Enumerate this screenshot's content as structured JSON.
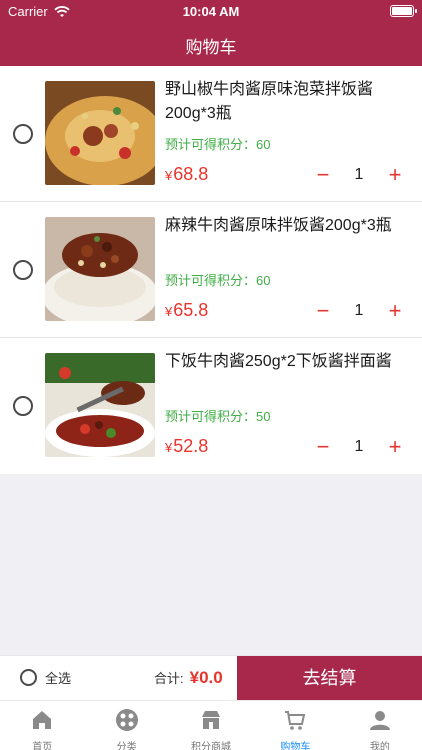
{
  "status": {
    "carrier": "Carrier",
    "time": "10:04 AM"
  },
  "header": {
    "title": "购物车"
  },
  "items": [
    {
      "name": "野山椒牛肉酱原味泡菜拌饭酱200g*3瓶",
      "points_label": "预计可得积分：60",
      "currency": "¥",
      "price": "68.8",
      "qty": "1"
    },
    {
      "name": "麻辣牛肉酱原味拌饭酱200g*3瓶",
      "points_label": "预计可得积分：60",
      "currency": "¥",
      "price": "65.8",
      "qty": "1"
    },
    {
      "name": "下饭牛肉酱250g*2下饭酱拌面酱",
      "points_label": "预计可得积分：50",
      "currency": "¥",
      "price": "52.8",
      "qty": "1"
    }
  ],
  "qty_minus": "−",
  "qty_plus": "+",
  "footer": {
    "select_all": "全选",
    "total_label": "合计:",
    "total_amount": "¥0.0",
    "checkout": "去结算"
  },
  "tabs": [
    {
      "label": "首页",
      "icon": "home-icon"
    },
    {
      "label": "分类",
      "icon": "category-icon"
    },
    {
      "label": "积分商城",
      "icon": "points-mall-icon"
    },
    {
      "label": "购物车",
      "icon": "cart-icon"
    },
    {
      "label": "我的",
      "icon": "profile-icon"
    }
  ],
  "colors": {
    "brand": "#a8284c",
    "price": "#e8342c",
    "points": "#3fae45",
    "tab_active": "#1a8cff"
  }
}
